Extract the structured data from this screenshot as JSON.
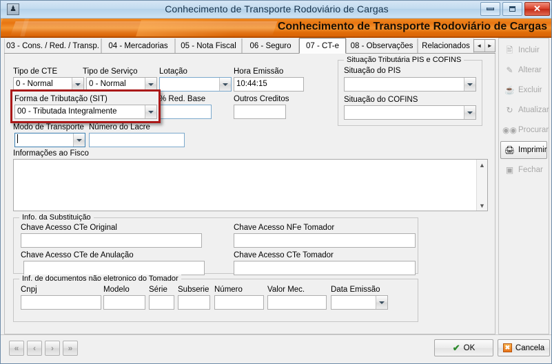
{
  "window": {
    "title": "Conhecimento de Transporte Rodoviário de Cargas",
    "banner_title": "Conhecimento de Transporte Rodoviário de Cargas",
    "app_icon": "application-icon",
    "minimize_label": "—",
    "maximize_label": "▫",
    "close_label": "✕"
  },
  "tabs": {
    "items": [
      {
        "label": "03 - Cons. / Red. / Transp.",
        "selected": false
      },
      {
        "label": "04 - Mercadorias",
        "selected": false
      },
      {
        "label": "05 - Nota Fiscal",
        "selected": false
      },
      {
        "label": "06 - Seguro",
        "selected": false
      },
      {
        "label": "07 - CT-e",
        "selected": true
      },
      {
        "label": "08 - Observações",
        "selected": false
      },
      {
        "label": "Relacionados",
        "selected": false
      }
    ],
    "scroll_left": "◄",
    "scroll_right": "►"
  },
  "form": {
    "tipo_cte": {
      "label": "Tipo de CTE",
      "value": "0 - Normal"
    },
    "tipo_servico": {
      "label": "Tipo de Serviço",
      "value": "0 - Normal"
    },
    "lotacao": {
      "label": "Lotação",
      "value": ""
    },
    "hora_emissao": {
      "label": "Hora Emissão",
      "value": "10:44:15"
    },
    "forma_tributacao": {
      "label": "Forma de Tributação (SIT)",
      "value": "00 - Tributada Integralmente"
    },
    "red_base": {
      "label": "% Red. Base",
      "value": ""
    },
    "outros_creditos": {
      "label": "Outros Creditos",
      "value": ""
    },
    "modo_transporte": {
      "label": "Modo de Transporte",
      "value": ""
    },
    "numero_lacre": {
      "label": "Número do Lacre",
      "value": ""
    },
    "informacoes_fisco": {
      "label": "Informações ao Fisco",
      "value": ""
    }
  },
  "pis_cofins": {
    "group_title": "Situação Tributária PIS e COFINS",
    "situacao_pis": {
      "label": "Situação do PIS",
      "value": ""
    },
    "situacao_cofins": {
      "label": "Situação do COFINS",
      "value": ""
    }
  },
  "substituicao": {
    "group_title": "Info. da Substituição",
    "chave_cte_original": {
      "label": "Chave Acesso CTe Original",
      "value": ""
    },
    "chave_nfe_tomador": {
      "label": "Chave Acesso NFe Tomador",
      "value": ""
    },
    "chave_cte_anulacao": {
      "label": "Chave Acesso CTe de Anulação",
      "value": ""
    },
    "chave_cte_tomador": {
      "label": "Chave Acesso CTe Tomador",
      "value": ""
    }
  },
  "doc_nao_eletronico": {
    "group_title": "Inf. de documentos não eletronico do Tomador",
    "columns": [
      {
        "label": "Cnpj",
        "value": ""
      },
      {
        "label": "Modelo",
        "value": ""
      },
      {
        "label": "Série",
        "value": ""
      },
      {
        "label": "Subserie",
        "value": ""
      },
      {
        "label": "Número",
        "value": ""
      },
      {
        "label": "Valor Mec.",
        "value": ""
      },
      {
        "label": "Data Emissão",
        "value": ""
      }
    ]
  },
  "actions": {
    "buttons": [
      {
        "label": "Incluir",
        "icon": "new-document-icon",
        "glyph": "📄",
        "enabled": false
      },
      {
        "label": "Alterar",
        "icon": "edit-pencil-icon",
        "glyph": "📝",
        "enabled": false
      },
      {
        "label": "Excluir",
        "icon": "trash-can-icon",
        "glyph": "🗑",
        "enabled": false
      },
      {
        "label": "Atualizar",
        "icon": "refresh-icon",
        "glyph": "🔄",
        "enabled": false
      },
      {
        "label": "Procurar",
        "icon": "binoculars-icon",
        "glyph": "🔍",
        "enabled": false
      },
      {
        "label": "Imprimir",
        "icon": "printer-icon",
        "glyph": "🖨",
        "enabled": true
      },
      {
        "label": "Fechar",
        "icon": "close-door-icon",
        "glyph": "🚪",
        "enabled": false
      }
    ]
  },
  "footer": {
    "nav": [
      {
        "label": "«",
        "name": "first"
      },
      {
        "label": "‹",
        "name": "previous"
      },
      {
        "label": "›",
        "name": "next"
      },
      {
        "label": "»",
        "name": "last"
      }
    ],
    "ok_label": "OK",
    "cancel_label": "Cancela",
    "ok_icon": "check-mark-icon",
    "cancel_icon": "cancel-x-icon"
  },
  "colors": {
    "banner_orange": "#e87511",
    "highlight_red": "#aa1818",
    "titlebar_blue": "#c3dbef",
    "form_background": "#f0f0f0"
  }
}
